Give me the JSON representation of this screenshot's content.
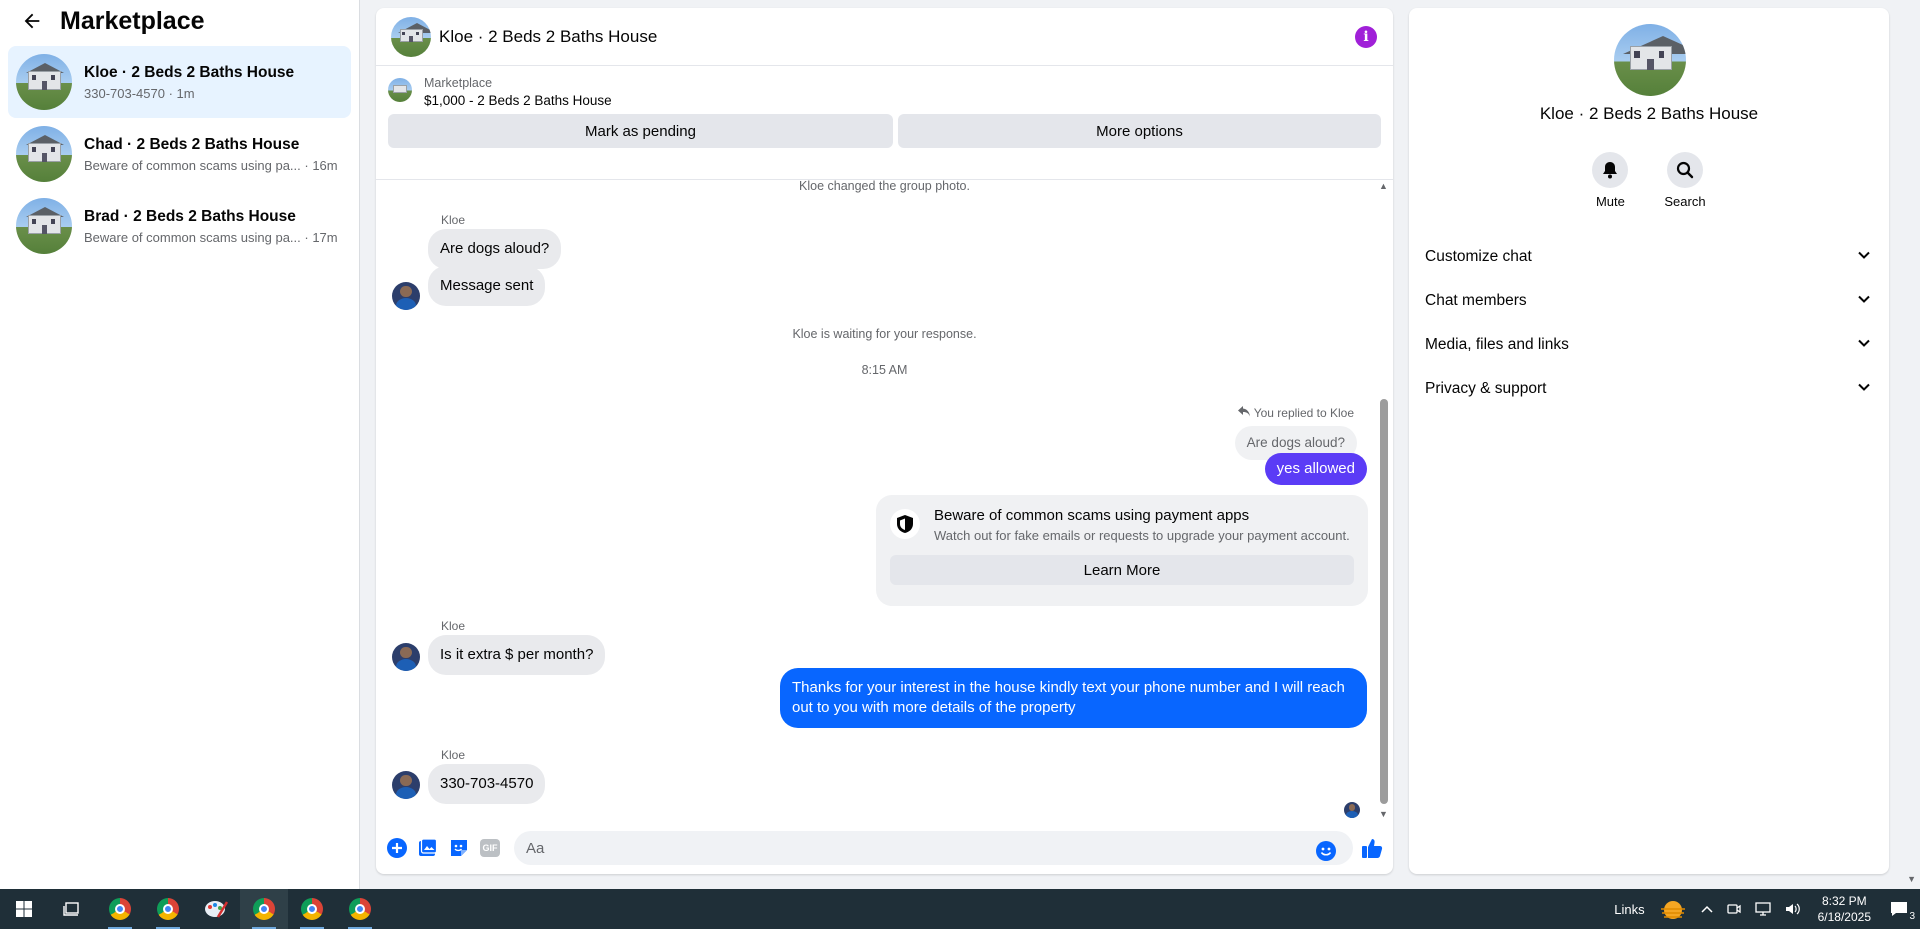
{
  "sidebar": {
    "title": "Marketplace",
    "conversations": [
      {
        "name": "Kloe · 2 Beds 2 Baths House",
        "subtitle": "330-703-4570 · 1m",
        "active": true
      },
      {
        "name": "Chad · 2 Beds 2 Baths House",
        "subtitle": "Beware of common scams using pa... · 16m",
        "active": false
      },
      {
        "name": "Brad · 2 Beds 2 Baths House",
        "subtitle": "Beware of common scams using pa... · 17m",
        "active": false
      }
    ]
  },
  "chat": {
    "title": "Kloe · 2 Beds 2 Baths House",
    "listing": {
      "source": "Marketplace",
      "title": "$1,000 - 2 Beds 2 Baths House",
      "mark_pending_label": "Mark as pending",
      "more_options_label": "More options"
    },
    "messages": {
      "group_photo_notice": "Kloe changed the group photo.",
      "sender_1": "Kloe",
      "msg_dogs": "Are dogs aloud?",
      "msg_sent": "Message sent",
      "waiting_notice": "Kloe is waiting for your response.",
      "timestamp": "8:15 AM",
      "reply_notice": "You replied to Kloe",
      "quoted": "Are dogs aloud?",
      "msg_allowed": "yes allowed",
      "scam_title": "Beware of common scams using payment apps",
      "scam_text": "Watch out for fake emails or requests to upgrade your payment account.",
      "learn_more_label": "Learn More",
      "sender_2": "Kloe",
      "msg_extra": "Is it extra $ per month?",
      "msg_thanks": "Thanks for your interest in the house kindly text your phone number and I will reach out to you with more details of the property",
      "sender_3": "Kloe",
      "msg_phone": "330-703-4570"
    },
    "composer": {
      "placeholder": "Aa",
      "gif_label": "GIF"
    }
  },
  "details": {
    "name": "Kloe · 2 Beds 2 Baths House",
    "mute_label": "Mute",
    "search_label": "Search",
    "sections": [
      "Customize chat",
      "Chat members",
      "Media, files and links",
      "Privacy & support"
    ]
  },
  "taskbar": {
    "links_label": "Links",
    "time": "8:32 PM",
    "date": "6/18/2025",
    "notification_count": "3"
  },
  "colors": {
    "accent": "#0866ff",
    "outgoing_purple": "#5b3cf6",
    "info": "#a020d8",
    "active_conv": "#e7f3ff"
  }
}
